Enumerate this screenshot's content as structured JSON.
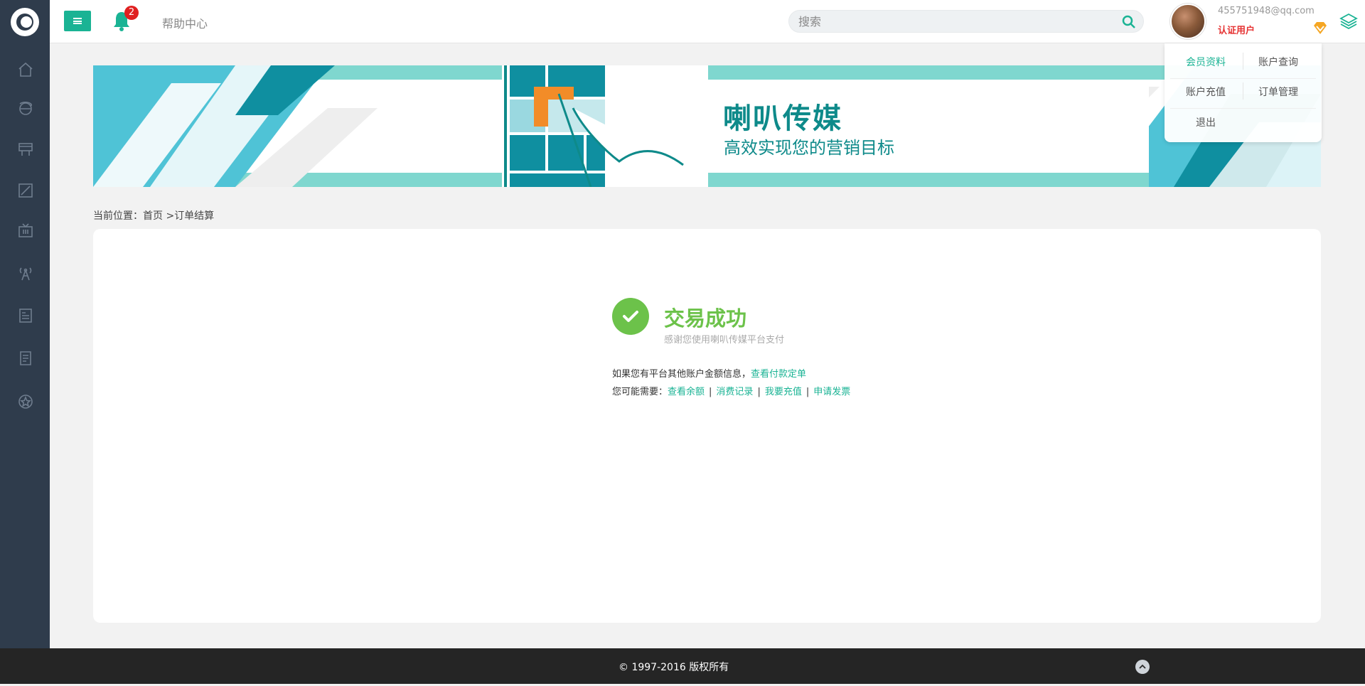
{
  "topbar": {
    "notification_count": "2",
    "help_label": "帮助中心",
    "search_placeholder": "搜索"
  },
  "user": {
    "email": "455751948@qq.com",
    "role": "认证用户"
  },
  "dropdown": {
    "items": [
      "会员资料",
      "账户查询",
      "账户充值",
      "订单管理",
      "退出"
    ]
  },
  "banner": {
    "title": "喇叭传媒",
    "subtitle": "高效实现您的营销目标"
  },
  "breadcrumb": {
    "prefix": "当前位置：",
    "home": "首页",
    "separator": " >",
    "current": "订单结算"
  },
  "result": {
    "title": "交易成功",
    "subtitle": "感谢您使用喇叭传媒平台支付",
    "line1_text": "如果您有平台其他账户金额信息，",
    "line1_link": "查看付款定单",
    "line2_text": "您可能需要：",
    "links": [
      "查看余额",
      "消费记录",
      "我要充值",
      "申请发票"
    ]
  },
  "footer": {
    "copyright": "© 1997-2016 版权所有"
  },
  "colors": {
    "accent": "#1ab394",
    "sidebar": "#2f3c4c",
    "success": "#6cc24a",
    "badge": "#e02020",
    "footer": "#252525"
  }
}
